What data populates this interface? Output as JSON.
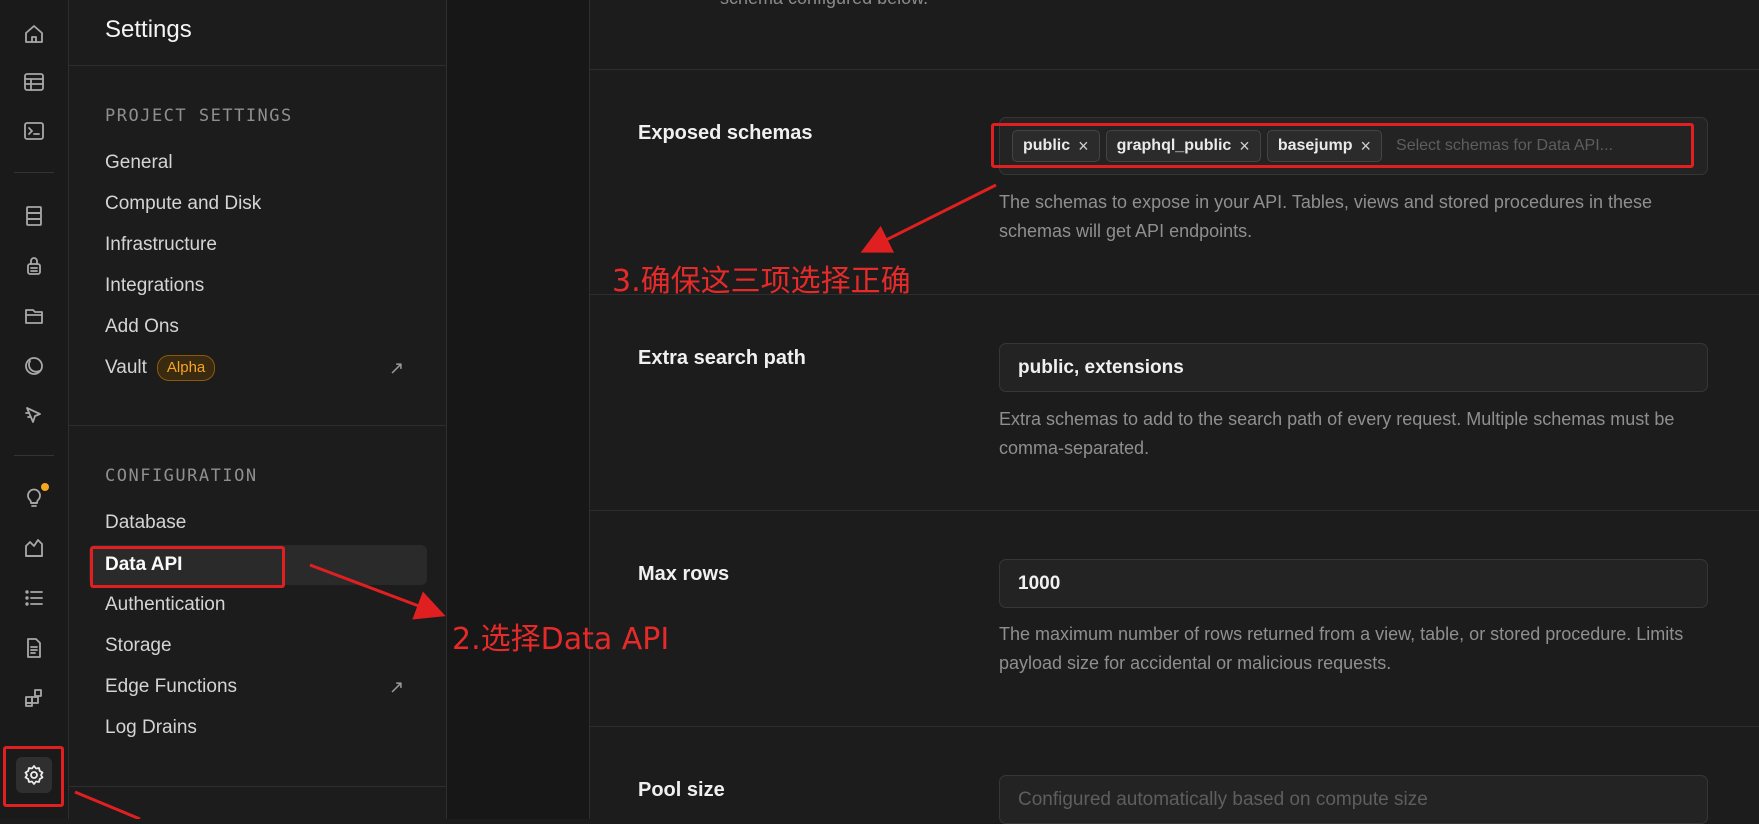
{
  "rail": {
    "icons": [
      "home-icon",
      "table-editor-icon",
      "sql-editor-icon",
      "database-icon",
      "auth-icon",
      "storage-icon",
      "realtime-icon",
      "edge-functions-icon",
      "advisors-icon",
      "reports-icon",
      "logs-icon",
      "api-docs-icon",
      "integrations-icon",
      "settings-icon"
    ]
  },
  "sidebar": {
    "title": "Settings",
    "project_section": "PROJECT SETTINGS",
    "project_items": [
      "General",
      "Compute and Disk",
      "Infrastructure",
      "Integrations",
      "Add Ons",
      "Vault"
    ],
    "vault_badge": "Alpha",
    "config_section": "CONFIGURATION",
    "config_items": [
      "Database",
      "Data API",
      "Authentication",
      "Storage",
      "Edge Functions",
      "Log Drains"
    ],
    "active_item": "Data API"
  },
  "main": {
    "top_clipped": "schema configured below.",
    "exposed": {
      "label": "Exposed schemas",
      "chips": [
        "public",
        "graphql_public",
        "basejump"
      ],
      "placeholder": "Select schemas for Data API...",
      "help": "The schemas to expose in your API. Tables, views and stored procedures in these schemas will get API endpoints."
    },
    "search_path": {
      "label": "Extra search path",
      "value": "public, extensions",
      "help": "Extra schemas to add to the search path of every request. Multiple schemas must be comma-separated."
    },
    "max_rows": {
      "label": "Max rows",
      "value": "1000",
      "help": "The maximum number of rows returned from a view, table, or stored procedure. Limits payload size for accidental or malicious requests."
    },
    "pool_size": {
      "label": "Pool size",
      "placeholder": "Configured automatically based on compute size"
    }
  },
  "annotations": {
    "step2": "2.选择Data API",
    "step3": "3.确保这三项选择正确",
    "color": "#e02020"
  }
}
